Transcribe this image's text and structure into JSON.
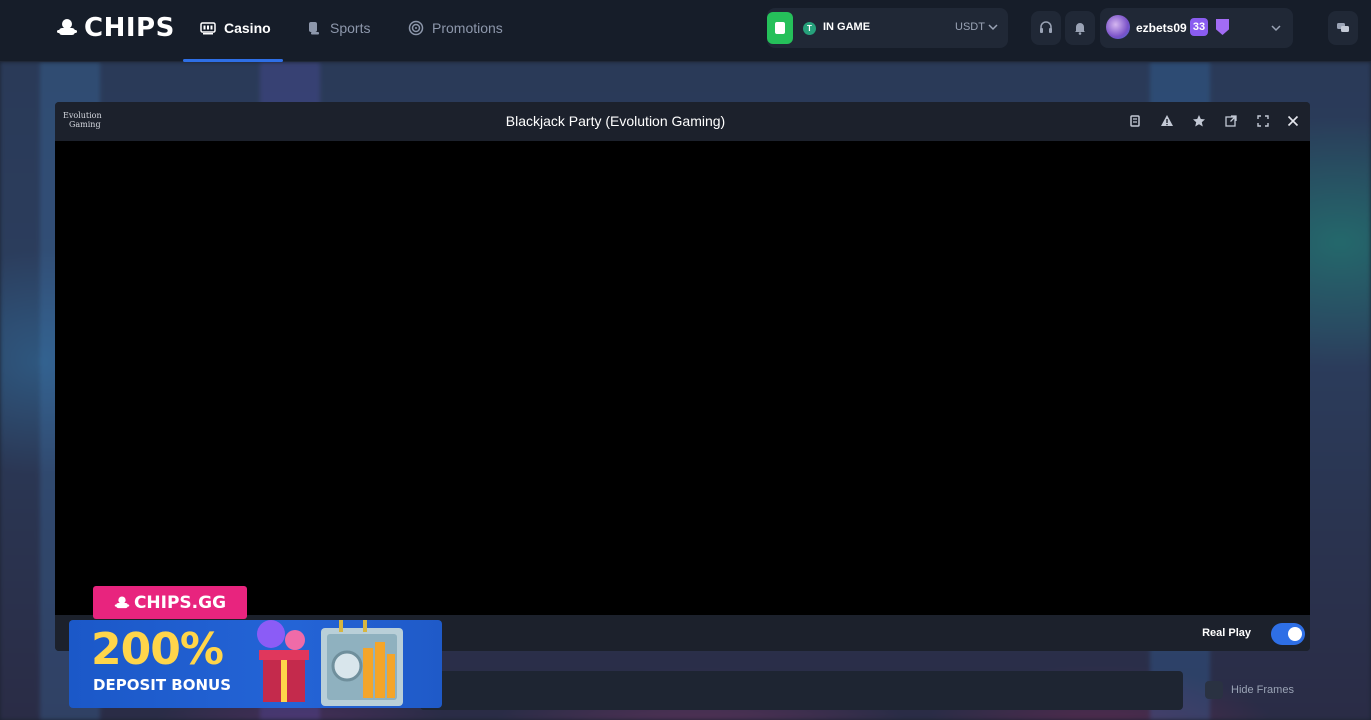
{
  "header": {
    "brand": "CHIPS",
    "nav": [
      {
        "label": "Casino",
        "active": true
      },
      {
        "label": "Sports",
        "active": false
      },
      {
        "label": "Promotions",
        "active": false
      }
    ],
    "wallet": {
      "status": "IN GAME",
      "currency": "USDT",
      "coin_icon": "tether-icon",
      "coin_letter": "T"
    },
    "username": "ezbets09",
    "level": "33"
  },
  "game": {
    "provider": "Evolution Gaming",
    "provider_logo_lines": [
      "Evolution",
      "Gaming"
    ],
    "title": "Blackjack Party (Evolution Gaming)",
    "tools": [
      "stats-icon",
      "warning-icon",
      "star-icon",
      "external-link-icon",
      "fullscreen-icon",
      "close-icon"
    ],
    "real_play_label": "Real Play",
    "real_play_on": true
  },
  "hide_frames_label": "Hide Frames",
  "promo": {
    "tag": "CHIPS.GG",
    "percent": "200%",
    "subtitle": "DEPOSIT BONUS"
  },
  "colors": {
    "accent_blue": "#2e6fe6",
    "wallet_green": "#25c05a",
    "promo_pink": "#e8247e",
    "promo_yellow": "#ffd54a",
    "level_purple": "#8a5cf0"
  }
}
